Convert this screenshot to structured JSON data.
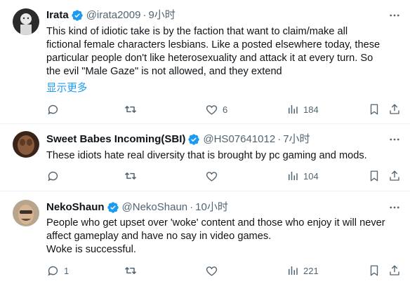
{
  "tweets": [
    {
      "name": "Irata",
      "verified": true,
      "handle": "@irata2009",
      "dot": "·",
      "time": "9小时",
      "lines": [
        "This kind of idiotic take is by the faction that want to claim/make all",
        "fictional female characters lesbians.  Like a posted elsewhere today, these",
        "particular people don't like heterosexuality and attack it at every turn.  So",
        "the evil \"Male Gaze\" is not allowed, and they extend"
      ],
      "show_more": "显示更多",
      "reply_count": "",
      "retweet_count": "",
      "like_count": "6",
      "views_count": "184"
    },
    {
      "name": "Sweet Babes Incoming(SBI)",
      "verified": true,
      "handle": "@HS07641012",
      "dot": "·",
      "time": "7小时",
      "lines": [
        "These idiots hate real diversity that is brought by pc gaming and mods."
      ],
      "reply_count": "",
      "retweet_count": "",
      "like_count": "",
      "views_count": "104"
    },
    {
      "name": "NekoShaun",
      "verified": true,
      "handle": "@NekoShaun",
      "dot": "·",
      "time": "10小时",
      "lines": [
        "People who get upset over 'woke' content and those who enjoy it will never",
        "affect gameplay and have no say in video games.",
        "Woke is successful."
      ],
      "reply_count": "1",
      "retweet_count": "",
      "like_count": "",
      "views_count": "221"
    }
  ],
  "colors": {
    "text": "#0f1419",
    "muted": "#536471",
    "accent": "#1d9bf0",
    "divider": "#eff3f4"
  },
  "icons": [
    "more-icon",
    "verified-icon",
    "reply-icon",
    "retweet-icon",
    "like-icon",
    "views-icon",
    "bookmark-icon",
    "share-icon"
  ]
}
